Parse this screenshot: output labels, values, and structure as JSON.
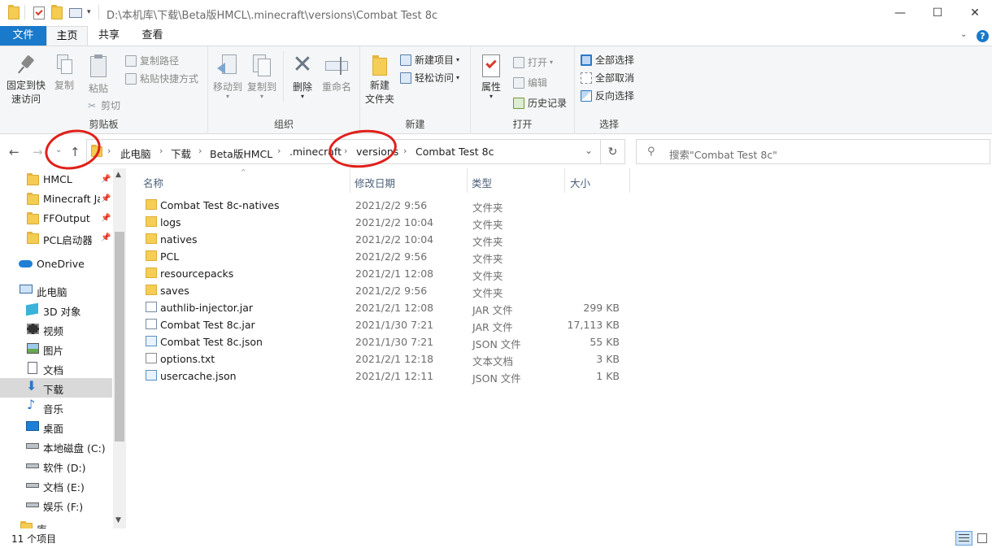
{
  "window": {
    "title": "D:\\本机库\\下载\\Beta版HMCL\\.minecraft\\versions\\Combat Test 8c",
    "minimize": "—",
    "maximize": "☐",
    "close": "✕"
  },
  "tabs": [
    {
      "label": "文件"
    },
    {
      "label": "主页"
    },
    {
      "label": "共享"
    },
    {
      "label": "查看"
    }
  ],
  "ribbon": {
    "clipboard": {
      "pin_line1": "固定到快",
      "pin_line2": "速访问",
      "copy": "复制",
      "paste": "粘贴",
      "copy_path": "复制路径",
      "paste_shortcut": "粘贴快捷方式",
      "cut": "剪切",
      "group": "剪贴板"
    },
    "organize": {
      "move_to": "移动到",
      "copy_to": "复制到",
      "delete": "删除",
      "rename": "重命名",
      "group": "组织"
    },
    "new": {
      "new_folder_line1": "新建",
      "new_folder_line2": "文件夹",
      "new_item": "新建项目",
      "easy_access": "轻松访问",
      "group": "新建"
    },
    "open": {
      "properties": "属性",
      "open": "打开",
      "edit": "编辑",
      "history": "历史记录",
      "group": "打开"
    },
    "select": {
      "select_all": "全部选择",
      "select_none": "全部取消",
      "invert": "反向选择",
      "group": "选择"
    }
  },
  "address": {
    "crumbs": [
      "此电脑",
      "下载",
      "Beta版HMCL",
      ".minecraft",
      "versions",
      "Combat Test 8c"
    ]
  },
  "search": {
    "placeholder": "搜索\"Combat Test 8c\""
  },
  "nav": {
    "quick_access": [
      {
        "label": "HMCL"
      },
      {
        "label": "Minecraft Ja"
      },
      {
        "label": "FFOutput"
      },
      {
        "label": "PCL启动器"
      }
    ],
    "onedrive": "OneDrive",
    "this_pc": "此电脑",
    "pc_items": [
      {
        "label": "3D 对象"
      },
      {
        "label": "视频"
      },
      {
        "label": "图片"
      },
      {
        "label": "文档"
      },
      {
        "label": "下载"
      },
      {
        "label": "音乐"
      },
      {
        "label": "桌面"
      },
      {
        "label": "本地磁盘 (C:)"
      },
      {
        "label": "软件 (D:)"
      },
      {
        "label": "文档 (E:)"
      },
      {
        "label": "娱乐 (F:)"
      },
      {
        "label": "库"
      }
    ]
  },
  "columns": {
    "name": "名称",
    "date": "修改日期",
    "type": "类型",
    "size": "大小"
  },
  "files": [
    {
      "name": "Combat Test 8c-natives",
      "date": "2021/2/2 9:56",
      "type": "文件夹",
      "size": "",
      "icon": "folder-icon"
    },
    {
      "name": "logs",
      "date": "2021/2/2 10:04",
      "type": "文件夹",
      "size": "",
      "icon": "folder-icon"
    },
    {
      "name": "natives",
      "date": "2021/2/2 10:04",
      "type": "文件夹",
      "size": "",
      "icon": "folder-icon"
    },
    {
      "name": "PCL",
      "date": "2021/2/2 9:56",
      "type": "文件夹",
      "size": "",
      "icon": "folder-icon"
    },
    {
      "name": "resourcepacks",
      "date": "2021/2/1 12:08",
      "type": "文件夹",
      "size": "",
      "icon": "folder-icon"
    },
    {
      "name": "saves",
      "date": "2021/2/2 9:56",
      "type": "文件夹",
      "size": "",
      "icon": "folder-icon"
    },
    {
      "name": "authlib-injector.jar",
      "date": "2021/2/1 12:08",
      "type": "JAR 文件",
      "size": "299 KB",
      "icon": "jar-icon"
    },
    {
      "name": "Combat Test 8c.jar",
      "date": "2021/1/30 7:21",
      "type": "JAR 文件",
      "size": "17,113 KB",
      "icon": "jar-icon"
    },
    {
      "name": "Combat Test 8c.json",
      "date": "2021/1/30 7:21",
      "type": "JSON 文件",
      "size": "55 KB",
      "icon": "json-icon"
    },
    {
      "name": "options.txt",
      "date": "2021/2/1 12:18",
      "type": "文本文档",
      "size": "3 KB",
      "icon": "txt-icon"
    },
    {
      "name": "usercache.json",
      "date": "2021/2/1 12:11",
      "type": "JSON 文件",
      "size": "1 KB",
      "icon": "json-icon"
    }
  ],
  "status": {
    "count": "11 个项目"
  },
  "colors": {
    "accent": "#1979ca",
    "annotation": "#e0201a",
    "folder": "#f6cd55"
  }
}
